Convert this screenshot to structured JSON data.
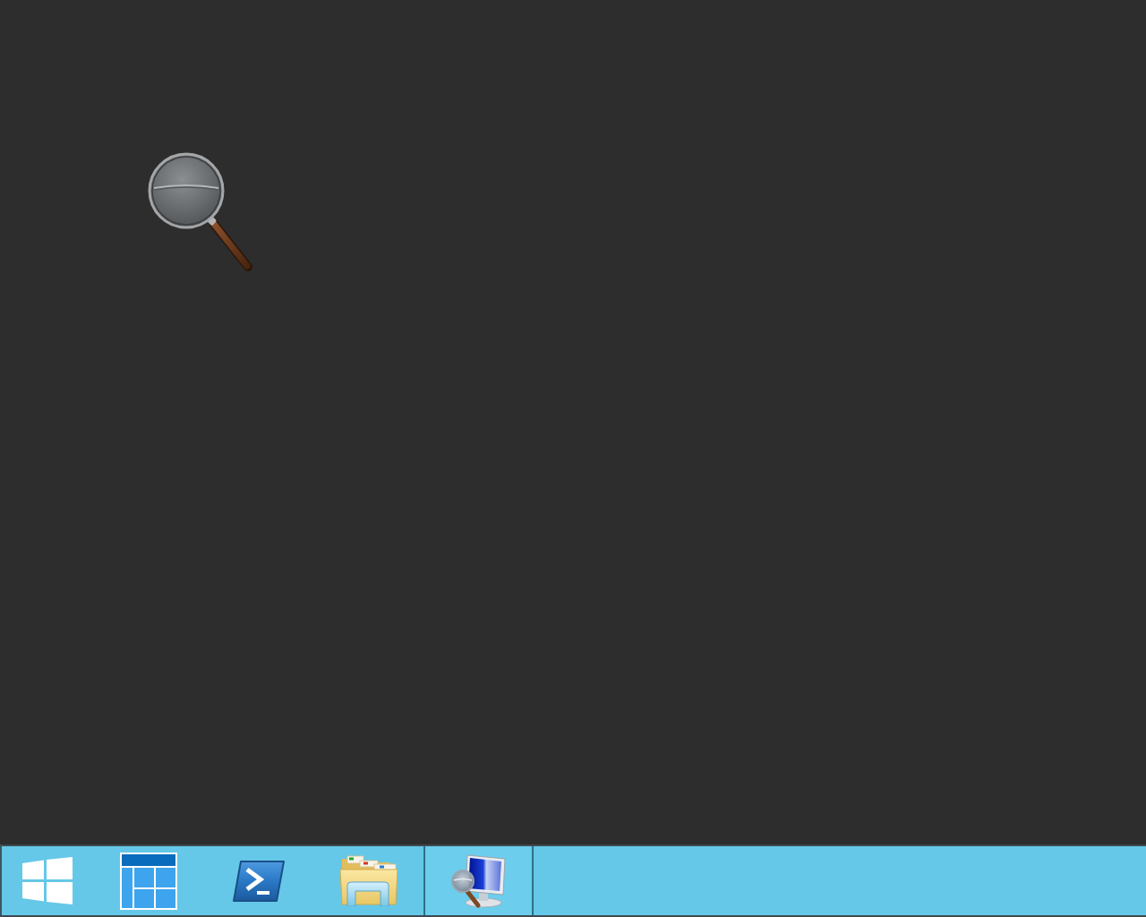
{
  "desktop": {
    "icons": [
      {
        "kind": "magnifier"
      }
    ]
  },
  "taskbar": {
    "items": [
      {
        "kind": "start",
        "selected": false
      },
      {
        "kind": "tiles",
        "selected": false
      },
      {
        "kind": "terminal",
        "selected": false
      },
      {
        "kind": "folder",
        "selected": false
      },
      {
        "kind": "monitor",
        "selected": true
      }
    ]
  }
}
